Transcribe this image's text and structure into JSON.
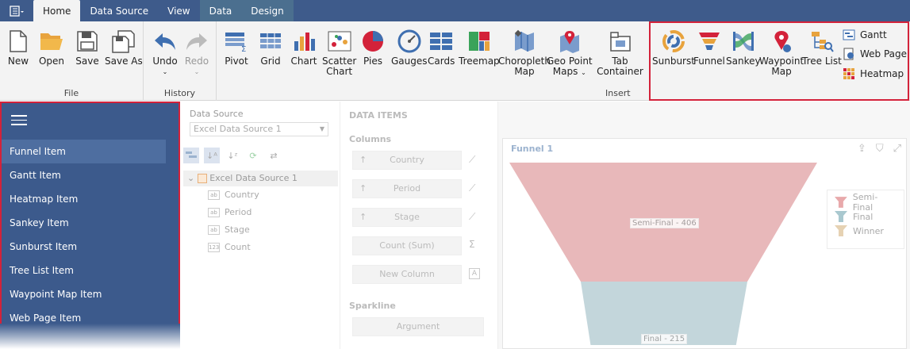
{
  "tabs": {
    "items": [
      "Home",
      "Data Source",
      "View"
    ],
    "context": [
      "Data",
      "Design"
    ]
  },
  "ribbon": {
    "file": {
      "label": "File",
      "new": "New",
      "open": "Open",
      "save": "Save",
      "save_as": "Save As"
    },
    "history": {
      "label": "History",
      "undo": "Undo",
      "redo": "Redo"
    },
    "insert": {
      "label": "Insert",
      "pivot": "Pivot",
      "grid": "Grid",
      "chart": "Chart",
      "scatter_line1": "Scatter",
      "scatter_line2": "Chart",
      "pies": "Pies",
      "gauges": "Gauges",
      "cards": "Cards",
      "treemap": "Treemap",
      "choropleth_line1": "Choropleth",
      "choropleth_line2": "Map",
      "geopoint_line1": "Geo Point",
      "geopoint_line2": "Maps",
      "tab_container": "Tab Container"
    },
    "custom": {
      "sunburst": "Sunburst",
      "funnel": "Funnel",
      "sankey": "Sankey",
      "waypoint_line1": "Waypoint",
      "waypoint_line2": "Map",
      "tree_list": "Tree List",
      "gantt": "Gantt",
      "web_page": "Web Page",
      "heatmap": "Heatmap"
    }
  },
  "sidenav": {
    "items": [
      "Funnel Item",
      "Gantt Item",
      "Heatmap Item",
      "Sankey Item",
      "Sunburst Item",
      "Tree List Item",
      "Waypoint Map Item",
      "Web Page Item"
    ]
  },
  "datasource": {
    "label": "Data Source",
    "selected": "Excel Data Source 1",
    "tree_root": "Excel Data Source 1",
    "fields": [
      {
        "type": "ab",
        "name": "Country"
      },
      {
        "type": "ab",
        "name": "Period"
      },
      {
        "type": "ab",
        "name": "Stage"
      },
      {
        "type": "123",
        "name": "Count"
      }
    ]
  },
  "data_items": {
    "header": "DATA ITEMS",
    "columns_label": "Columns",
    "columns": [
      "Country",
      "Period",
      "Stage",
      "Count (Sum)",
      "New Column"
    ],
    "sparkline_label": "Sparkline",
    "argument": "Argument"
  },
  "dashboard": {
    "title": "Funnel 1",
    "legend": [
      {
        "name": "Semi-Final",
        "color": "#e8a9ab"
      },
      {
        "name": "Final",
        "color": "#a9c8cf"
      },
      {
        "name": "Winner",
        "color": "#e6d2b3"
      }
    ],
    "labels": [
      "Semi-Final - 406",
      "Final - 215"
    ]
  },
  "colors": {
    "accent": "#3e5b8b",
    "highlight": "#d3223a"
  }
}
